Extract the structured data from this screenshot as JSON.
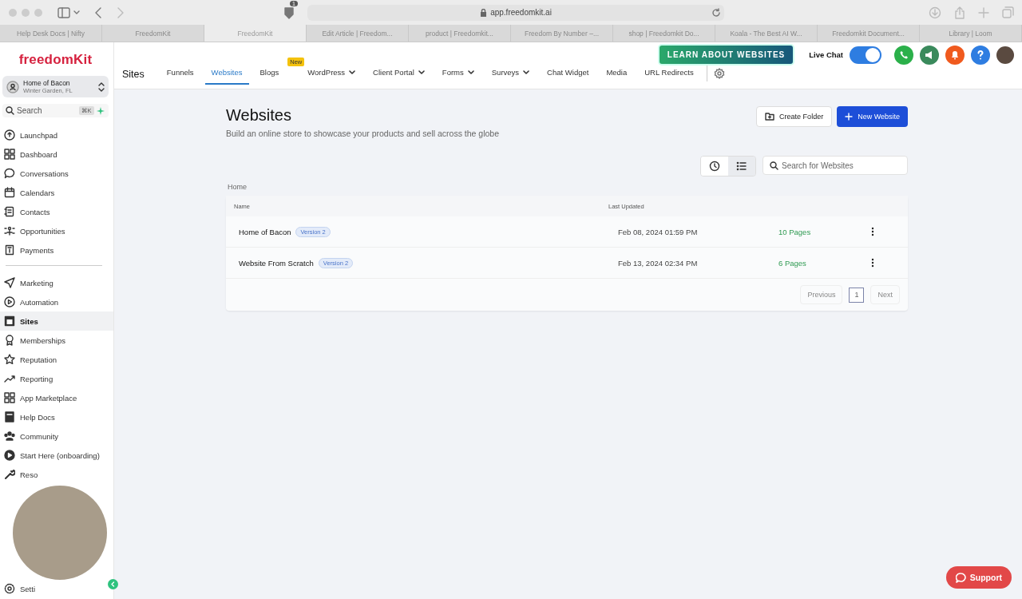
{
  "browser": {
    "address": "app.freedomkit.ai",
    "extension_badge": "1",
    "tabs": [
      {
        "title": "Help Desk Docs | Nifty",
        "selected": false
      },
      {
        "title": "FreedomKit",
        "selected": false
      },
      {
        "title": "FreedomKit",
        "selected": true
      },
      {
        "title": "Edit Article | Freedom...",
        "selected": false
      },
      {
        "title": "product | Freedomkit...",
        "selected": false
      },
      {
        "title": "Freedom By Number –...",
        "selected": false
      },
      {
        "title": "shop | Freedomkit Do...",
        "selected": false
      },
      {
        "title": "Koala - The Best AI W...",
        "selected": false
      },
      {
        "title": "Freedomkit Document...",
        "selected": false
      },
      {
        "title": "Library | Loom",
        "selected": false
      }
    ]
  },
  "sidebar": {
    "logo": "freedomKit",
    "account": {
      "name": "Home of Bacon",
      "location": "Winter Garden, FL"
    },
    "search": {
      "placeholder": "Search",
      "shortcut": "⌘K"
    },
    "groups": [
      [
        {
          "label": "Launchpad",
          "selected": false
        },
        {
          "label": "Dashboard",
          "selected": false
        },
        {
          "label": "Conversations",
          "selected": false
        },
        {
          "label": "Calendars",
          "selected": false
        },
        {
          "label": "Contacts",
          "selected": false
        },
        {
          "label": "Opportunities",
          "selected": false
        },
        {
          "label": "Payments",
          "selected": false
        }
      ],
      [
        {
          "label": "Marketing",
          "selected": false
        },
        {
          "label": "Automation",
          "selected": false
        },
        {
          "label": "Sites",
          "selected": true
        },
        {
          "label": "Memberships",
          "selected": false
        },
        {
          "label": "Reputation",
          "selected": false
        },
        {
          "label": "Reporting",
          "selected": false
        },
        {
          "label": "App Marketplace",
          "selected": false
        },
        {
          "label": "Help Docs",
          "selected": false
        },
        {
          "label": "Community",
          "selected": false
        },
        {
          "label": "Start Here (onboarding)",
          "selected": false
        },
        {
          "label": "Reso",
          "selected": false
        }
      ]
    ],
    "bottom_item": {
      "label": "Setti"
    }
  },
  "header": {
    "section": "Sites",
    "nav": [
      {
        "label": "Funnels",
        "selected": false,
        "kind": "link"
      },
      {
        "label": "Websites",
        "selected": true,
        "kind": "link"
      },
      {
        "label": "Blogs",
        "selected": false,
        "kind": "link",
        "badge": "New"
      },
      {
        "label": "WordPress",
        "selected": false,
        "kind": "dropdown"
      },
      {
        "label": "Client Portal",
        "selected": false,
        "kind": "dropdown"
      },
      {
        "label": "Forms",
        "selected": false,
        "kind": "dropdown"
      },
      {
        "label": "Surveys",
        "selected": false,
        "kind": "dropdown"
      },
      {
        "label": "Chat Widget",
        "selected": false,
        "kind": "link"
      },
      {
        "label": "Media",
        "selected": false,
        "kind": "link"
      },
      {
        "label": "URL Redirects",
        "selected": false,
        "kind": "link"
      }
    ],
    "promo_button": "LEARN ABOUT WEBSITES",
    "live_chat": {
      "label": "Live Chat",
      "on": true
    }
  },
  "page": {
    "title": "Websites",
    "subtitle": "Build an online store to showcase your products and sell across the globe",
    "buttons": {
      "create_folder": "Create Folder",
      "new_website": "New Website"
    },
    "views": [
      {
        "kind": "recent",
        "selected": false
      },
      {
        "kind": "list",
        "selected": true
      }
    ],
    "search": {
      "placeholder": "Search for Websites"
    },
    "breadcrumb": "Home",
    "table": {
      "columns": [
        "Name",
        "Last Updated"
      ],
      "rows": [
        {
          "name": "Home of Bacon",
          "version": "Version 2",
          "updated": "Feb 08, 2024 01:59 PM",
          "pages": "10 Pages"
        },
        {
          "name": "Website From Scratch",
          "version": "Version 2",
          "updated": "Feb 13, 2024 02:34 PM",
          "pages": "6 Pages"
        }
      ]
    },
    "pagination": {
      "previous": "Previous",
      "pages": [
        {
          "label": "1",
          "selected": true
        }
      ],
      "next": "Next"
    }
  },
  "support_button": "Support"
}
